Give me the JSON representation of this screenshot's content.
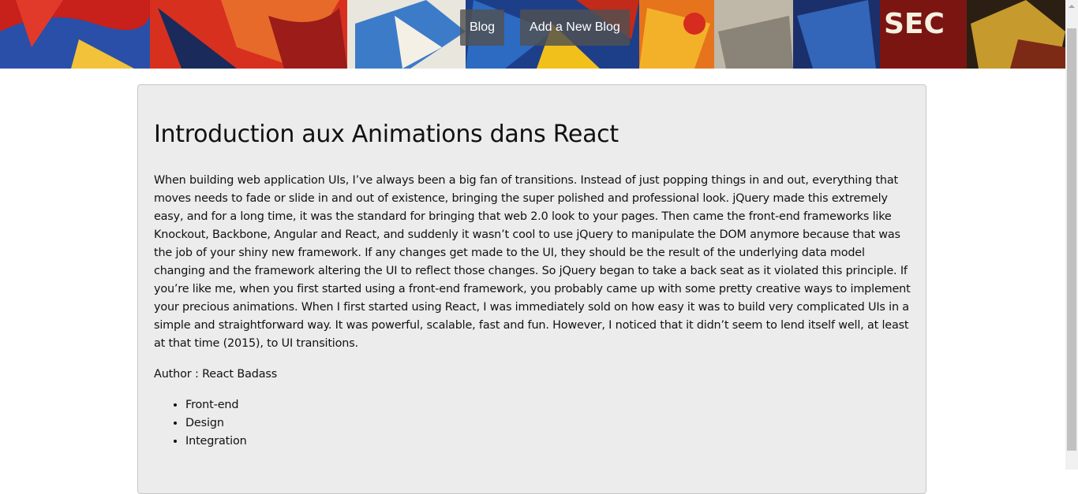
{
  "nav": {
    "items": [
      {
        "label": "Blog"
      },
      {
        "label": "Add a New Blog"
      }
    ]
  },
  "post": {
    "title": "Introduction aux Animations dans React",
    "body": "When building web application UIs, I’ve always been a big fan of transitions. Instead of just popping things in and out, everything that moves needs to fade or slide in and out of existence, bringing the super polished and professional look. jQuery made this extremely easy, and for a long time, it was the standard for bringing that web 2.0 look to your pages. Then came the front-end frameworks like Knockout, Backbone, Angular and React, and suddenly it wasn’t cool to use jQuery to manipulate the DOM anymore because that was the job of your shiny new framework. If any changes get made to the UI, they should be the result of the underlying data model changing and the framework altering the UI to reflect those changes. So jQuery began to take a back seat as it violated this principle. If you’re like me, when you first started using a front-end framework, you probably came up with some pretty creative ways to implement your precious animations. When I first started using React, I was immediately sold on how easy it was to build very complicated UIs in a simple and straightforward way. It was powerful, scalable, fast and fun. However, I noticed that it didn’t seem to lend itself well, at least at that time (2015), to UI transitions.",
    "author": "Author : React Badass",
    "tags": [
      "Front-end",
      "Design",
      "Integration"
    ]
  },
  "colors": {
    "card_background": "#ececec",
    "nav_background": "#505050",
    "text": "#111111"
  }
}
